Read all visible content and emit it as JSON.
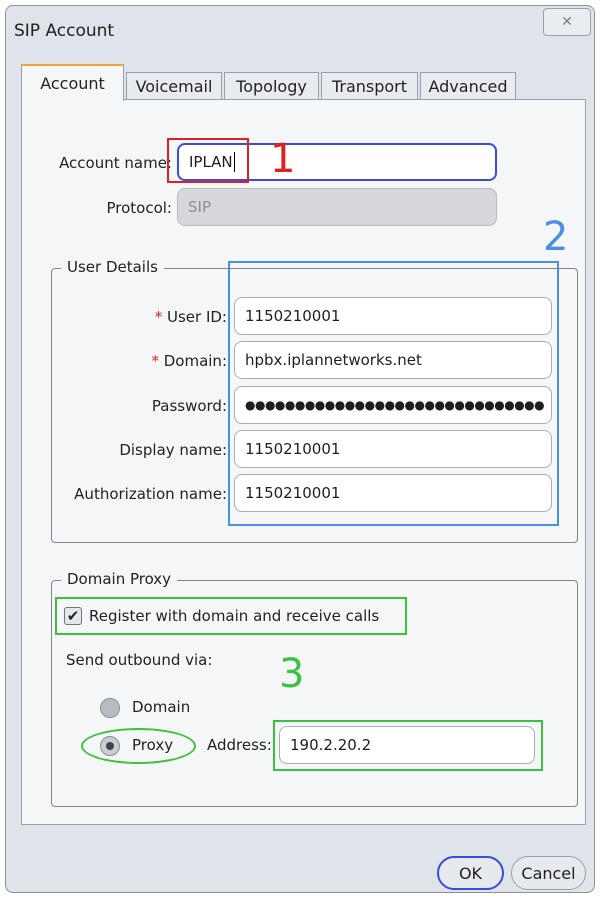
{
  "window": {
    "title": "SIP Account",
    "close_icon": "✕"
  },
  "tabs": [
    {
      "label": "Account"
    },
    {
      "label": "Voicemail"
    },
    {
      "label": "Topology"
    },
    {
      "label": "Transport"
    },
    {
      "label": "Advanced"
    }
  ],
  "account": {
    "name_label": "Account name:",
    "name_value": "IPLAN",
    "protocol_label": "Protocol:",
    "protocol_value": "SIP"
  },
  "user_details": {
    "legend": "User Details",
    "required_mark": "*",
    "user_id_label": "User ID:",
    "user_id_value": "1150210001",
    "domain_label": "Domain:",
    "domain_value": "hpbx.iplannetworks.net",
    "password_label": "Password:",
    "password_value": "●●●●●●●●●●●●●●●●●●●●●●●●●●●●●●",
    "display_name_label": "Display name:",
    "display_name_value": "1150210001",
    "auth_name_label": "Authorization name:",
    "auth_name_value": "1150210001"
  },
  "domain_proxy": {
    "legend": "Domain Proxy",
    "register_label": "Register with domain and receive calls",
    "register_checked": true,
    "send_outbound_label": "Send outbound via:",
    "domain_option": "Domain",
    "proxy_option": "Proxy",
    "selected": "Proxy",
    "address_label": "Address:",
    "address_value": "190.2.20.2"
  },
  "annotations": {
    "one": "1",
    "two": "2",
    "three": "3"
  },
  "buttons": {
    "ok": "OK",
    "cancel": "Cancel"
  },
  "colors": {
    "anno_red": "#e02020",
    "anno_blue": "#4a90e2",
    "anno_green": "#3cc13c",
    "focus_blue": "#3b4be0",
    "tab_accent": "#f3a23c"
  }
}
